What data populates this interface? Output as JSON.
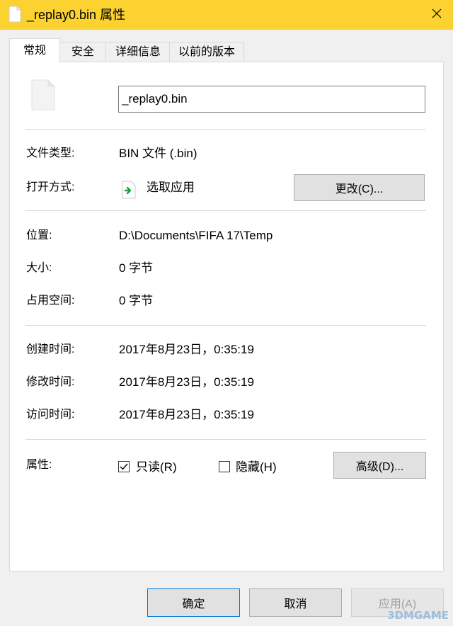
{
  "window": {
    "title": "_replay0.bin 属性",
    "close_icon": "close-icon"
  },
  "tabs": [
    {
      "label": "常规",
      "active": true
    },
    {
      "label": "安全",
      "active": false
    },
    {
      "label": "详细信息",
      "active": false
    },
    {
      "label": "以前的版本",
      "active": false
    }
  ],
  "general": {
    "file_name": "_replay0.bin",
    "rows": {
      "file_type": {
        "label": "文件类型:",
        "value": "BIN 文件 (.bin)"
      },
      "open_with": {
        "label": "打开方式:",
        "value": "选取应用",
        "button": "更改(C)..."
      },
      "location": {
        "label": "位置:",
        "value": "D:\\Documents\\FIFA 17\\Temp"
      },
      "size": {
        "label": "大小:",
        "value": "0 字节"
      },
      "size_on_disk": {
        "label": "占用空间:",
        "value": "0 字节"
      },
      "created": {
        "label": "创建时间:",
        "value": "2017年8月23日，0:35:19"
      },
      "modified": {
        "label": "修改时间:",
        "value": "2017年8月23日，0:35:19"
      },
      "accessed": {
        "label": "访问时间:",
        "value": "2017年8月23日，0:35:19"
      }
    },
    "attributes": {
      "label": "属性:",
      "readonly": {
        "label": "只读(R)",
        "checked": true
      },
      "hidden": {
        "label": "隐藏(H)",
        "checked": false
      },
      "advanced_button": "高级(D)..."
    }
  },
  "footer": {
    "ok": "确定",
    "cancel": "取消",
    "apply": "应用(A)"
  },
  "watermark": "3DMGAME",
  "colors": {
    "titlebar": "#fbd230",
    "dialog_bg": "#f0f0f0",
    "accent": "#0078d7"
  }
}
